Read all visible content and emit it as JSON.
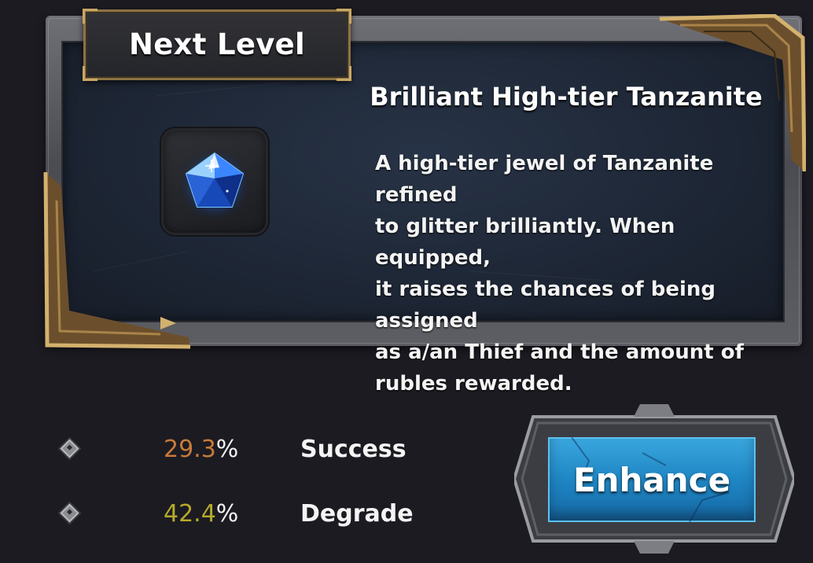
{
  "panel": {
    "title": "Next Level",
    "item_name": "Brilliant High-tier Tanzanite",
    "description": "A high-tier jewel of Tanzanite refined to glitter brilliantly. When equipped, it raises the chances of being assigned as a/an Thief and the amount of rubles rewarded.",
    "description_lines": [
      "A high-tier jewel of Tanzanite refined",
      "to glitter brilliantly. When equipped,",
      "it raises the chances of being assigned",
      "as a/an Thief and the amount of",
      "rubles rewarded."
    ],
    "icon": "tanzanite-gem-icon"
  },
  "stats": [
    {
      "value": "29.3",
      "unit": "%",
      "label": "Success",
      "color": "#c77a3a",
      "icon": "diamond-bullet-icon"
    },
    {
      "value": "42.4",
      "unit": "%",
      "label": "Degrade",
      "color": "#b5a92a",
      "icon": "diamond-bullet-icon"
    }
  ],
  "actions": {
    "enhance_label": "Enhance",
    "enhance_color": "#1f86c4"
  },
  "colors": {
    "background": "#1c1b22",
    "panel_inner": "#1e2736",
    "frame_gold": "#c9a765"
  }
}
